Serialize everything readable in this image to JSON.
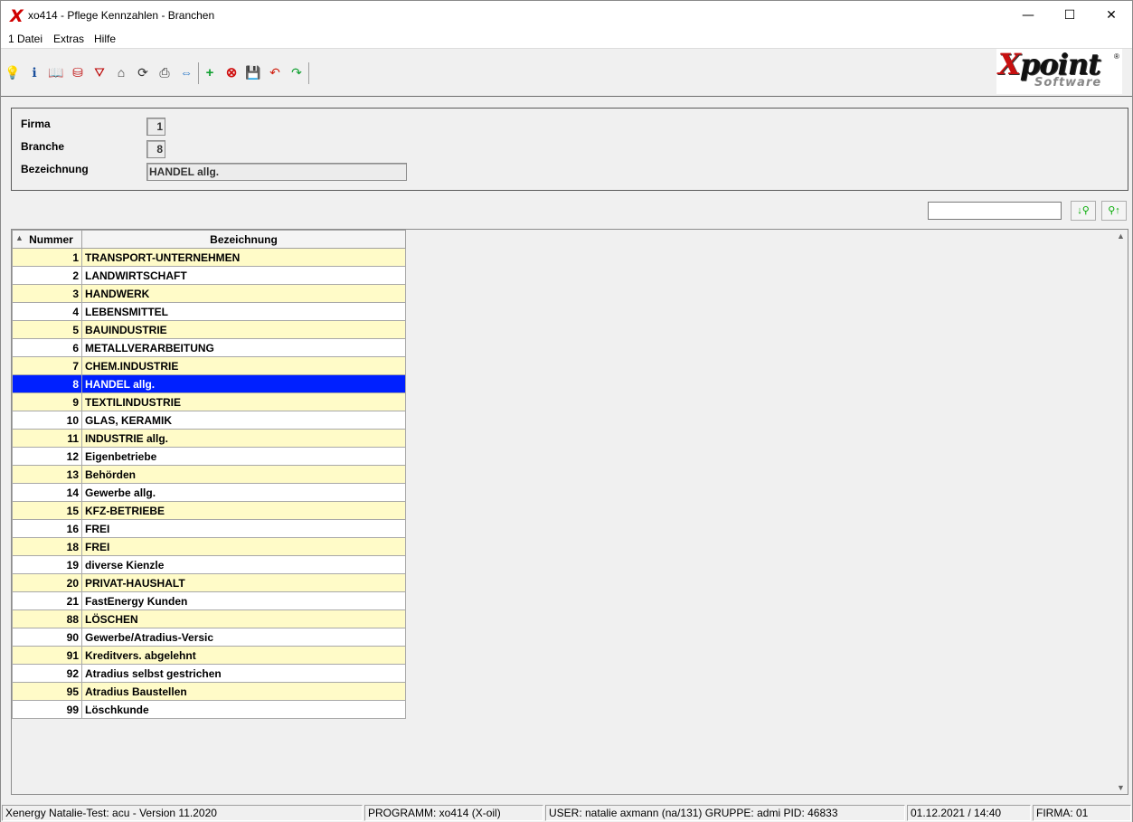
{
  "window": {
    "title": "xo414 - Pflege Kennzahlen - Branchen",
    "app_glyph": "X",
    "minimize_glyph": "—",
    "maximize_glyph": "☐",
    "close_glyph": "✕"
  },
  "menu": {
    "items": [
      "1 Datei",
      "Extras",
      "Hilfe"
    ]
  },
  "toolbar": {
    "icons": [
      {
        "name": "lightbulb-icon",
        "glyph": "💡"
      },
      {
        "name": "info-icon",
        "glyph": "ℹ"
      },
      {
        "name": "book-icon",
        "glyph": "📖"
      },
      {
        "name": "database-icon",
        "glyph": "⛁"
      },
      {
        "name": "filter-icon",
        "glyph": "⛛"
      },
      {
        "name": "home-icon",
        "glyph": "⌂"
      },
      {
        "name": "refresh-icon",
        "glyph": "⟳"
      },
      {
        "name": "print-icon",
        "glyph": "⎙"
      },
      {
        "name": "link-icon",
        "glyph": "⇔"
      },
      {
        "name": "add-icon",
        "glyph": "+"
      },
      {
        "name": "delete-icon",
        "glyph": "⊗"
      },
      {
        "name": "save-icon",
        "glyph": "💾"
      },
      {
        "name": "undo-icon",
        "glyph": "↶"
      },
      {
        "name": "redo-icon",
        "glyph": "↷"
      }
    ]
  },
  "logo": {
    "brand_x": "X",
    "brand_rest": "point",
    "sub": "Software",
    "reg": "®"
  },
  "header": {
    "firma_label": "Firma",
    "firma_value": "1",
    "branche_label": "Branche",
    "branche_value": "8",
    "bezeichnung_label": "Bezeichnung",
    "bezeichnung_value": "HANDEL allg."
  },
  "search": {
    "value": "",
    "find_down_label": "↓⚲",
    "find_up_label": "⚲↑"
  },
  "grid": {
    "columns": [
      "Nummer",
      "Bezeichnung"
    ],
    "sort_indicator": "▲",
    "selected_number": "8",
    "rows": [
      {
        "num": "1",
        "bez": "TRANSPORT-UNTERNEHMEN"
      },
      {
        "num": "2",
        "bez": "LANDWIRTSCHAFT"
      },
      {
        "num": "3",
        "bez": "HANDWERK"
      },
      {
        "num": "4",
        "bez": "LEBENSMITTEL"
      },
      {
        "num": "5",
        "bez": "BAUINDUSTRIE"
      },
      {
        "num": "6",
        "bez": "METALLVERARBEITUNG"
      },
      {
        "num": "7",
        "bez": "CHEM.INDUSTRIE"
      },
      {
        "num": "8",
        "bez": "HANDEL allg."
      },
      {
        "num": "9",
        "bez": "TEXTILINDUSTRIE"
      },
      {
        "num": "10",
        "bez": "GLAS, KERAMIK"
      },
      {
        "num": "11",
        "bez": "INDUSTRIE allg."
      },
      {
        "num": "12",
        "bez": "Eigenbetriebe"
      },
      {
        "num": "13",
        "bez": "Behörden"
      },
      {
        "num": "14",
        "bez": "Gewerbe allg."
      },
      {
        "num": "15",
        "bez": "KFZ-BETRIEBE"
      },
      {
        "num": "16",
        "bez": "FREI"
      },
      {
        "num": "18",
        "bez": "FREI"
      },
      {
        "num": "19",
        "bez": "diverse Kienzle"
      },
      {
        "num": "20",
        "bez": "PRIVAT-HAUSHALT"
      },
      {
        "num": "21",
        "bez": "FastEnergy Kunden"
      },
      {
        "num": "88",
        "bez": "LÖSCHEN"
      },
      {
        "num": "90",
        "bez": "Gewerbe/Atradius-Versic"
      },
      {
        "num": "91",
        "bez": "Kreditvers. abgelehnt"
      },
      {
        "num": "92",
        "bez": "Atradius selbst gestrichen"
      },
      {
        "num": "95",
        "bez": "Atradius Baustellen"
      },
      {
        "num": "99",
        "bez": "Löschkunde"
      }
    ]
  },
  "scrollbar": {
    "up": "▲",
    "down": "▼"
  },
  "status": {
    "version": "Xenergy Natalie-Test: acu - Version 11.2020",
    "program": "PROGRAMM: xo414 (X-oil)",
    "user": "USER: natalie axmann (na/131)  GRUPPE: admi  PID: 46833",
    "datetime": "01.12.2021 / 14:40",
    "firma": "FIRMA: 01"
  },
  "colors": {
    "selection": "#0020ff",
    "row_alt": "#fffbc8",
    "brand_red": "#c81010"
  }
}
